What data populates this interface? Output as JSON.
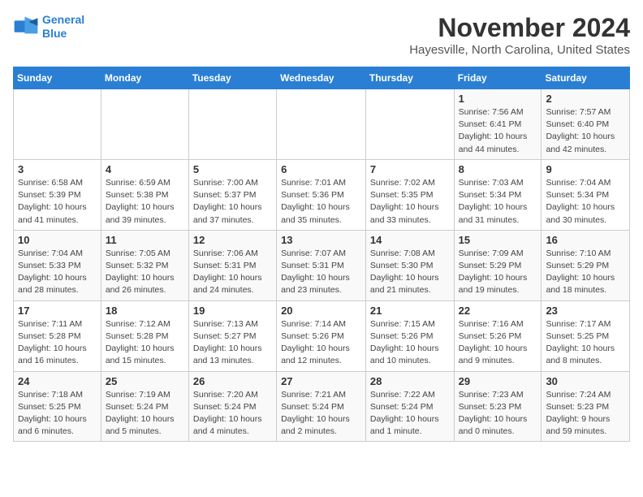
{
  "logo": {
    "line1": "General",
    "line2": "Blue"
  },
  "header": {
    "month_year": "November 2024",
    "location": "Hayesville, North Carolina, United States"
  },
  "days_of_week": [
    "Sunday",
    "Monday",
    "Tuesday",
    "Wednesday",
    "Thursday",
    "Friday",
    "Saturday"
  ],
  "weeks": [
    [
      {
        "day": "",
        "info": ""
      },
      {
        "day": "",
        "info": ""
      },
      {
        "day": "",
        "info": ""
      },
      {
        "day": "",
        "info": ""
      },
      {
        "day": "",
        "info": ""
      },
      {
        "day": "1",
        "info": "Sunrise: 7:56 AM\nSunset: 6:41 PM\nDaylight: 10 hours\nand 44 minutes."
      },
      {
        "day": "2",
        "info": "Sunrise: 7:57 AM\nSunset: 6:40 PM\nDaylight: 10 hours\nand 42 minutes."
      }
    ],
    [
      {
        "day": "3",
        "info": "Sunrise: 6:58 AM\nSunset: 5:39 PM\nDaylight: 10 hours\nand 41 minutes."
      },
      {
        "day": "4",
        "info": "Sunrise: 6:59 AM\nSunset: 5:38 PM\nDaylight: 10 hours\nand 39 minutes."
      },
      {
        "day": "5",
        "info": "Sunrise: 7:00 AM\nSunset: 5:37 PM\nDaylight: 10 hours\nand 37 minutes."
      },
      {
        "day": "6",
        "info": "Sunrise: 7:01 AM\nSunset: 5:36 PM\nDaylight: 10 hours\nand 35 minutes."
      },
      {
        "day": "7",
        "info": "Sunrise: 7:02 AM\nSunset: 5:35 PM\nDaylight: 10 hours\nand 33 minutes."
      },
      {
        "day": "8",
        "info": "Sunrise: 7:03 AM\nSunset: 5:34 PM\nDaylight: 10 hours\nand 31 minutes."
      },
      {
        "day": "9",
        "info": "Sunrise: 7:04 AM\nSunset: 5:34 PM\nDaylight: 10 hours\nand 30 minutes."
      }
    ],
    [
      {
        "day": "10",
        "info": "Sunrise: 7:04 AM\nSunset: 5:33 PM\nDaylight: 10 hours\nand 28 minutes."
      },
      {
        "day": "11",
        "info": "Sunrise: 7:05 AM\nSunset: 5:32 PM\nDaylight: 10 hours\nand 26 minutes."
      },
      {
        "day": "12",
        "info": "Sunrise: 7:06 AM\nSunset: 5:31 PM\nDaylight: 10 hours\nand 24 minutes."
      },
      {
        "day": "13",
        "info": "Sunrise: 7:07 AM\nSunset: 5:31 PM\nDaylight: 10 hours\nand 23 minutes."
      },
      {
        "day": "14",
        "info": "Sunrise: 7:08 AM\nSunset: 5:30 PM\nDaylight: 10 hours\nand 21 minutes."
      },
      {
        "day": "15",
        "info": "Sunrise: 7:09 AM\nSunset: 5:29 PM\nDaylight: 10 hours\nand 19 minutes."
      },
      {
        "day": "16",
        "info": "Sunrise: 7:10 AM\nSunset: 5:29 PM\nDaylight: 10 hours\nand 18 minutes."
      }
    ],
    [
      {
        "day": "17",
        "info": "Sunrise: 7:11 AM\nSunset: 5:28 PM\nDaylight: 10 hours\nand 16 minutes."
      },
      {
        "day": "18",
        "info": "Sunrise: 7:12 AM\nSunset: 5:28 PM\nDaylight: 10 hours\nand 15 minutes."
      },
      {
        "day": "19",
        "info": "Sunrise: 7:13 AM\nSunset: 5:27 PM\nDaylight: 10 hours\nand 13 minutes."
      },
      {
        "day": "20",
        "info": "Sunrise: 7:14 AM\nSunset: 5:26 PM\nDaylight: 10 hours\nand 12 minutes."
      },
      {
        "day": "21",
        "info": "Sunrise: 7:15 AM\nSunset: 5:26 PM\nDaylight: 10 hours\nand 10 minutes."
      },
      {
        "day": "22",
        "info": "Sunrise: 7:16 AM\nSunset: 5:26 PM\nDaylight: 10 hours\nand 9 minutes."
      },
      {
        "day": "23",
        "info": "Sunrise: 7:17 AM\nSunset: 5:25 PM\nDaylight: 10 hours\nand 8 minutes."
      }
    ],
    [
      {
        "day": "24",
        "info": "Sunrise: 7:18 AM\nSunset: 5:25 PM\nDaylight: 10 hours\nand 6 minutes."
      },
      {
        "day": "25",
        "info": "Sunrise: 7:19 AM\nSunset: 5:24 PM\nDaylight: 10 hours\nand 5 minutes."
      },
      {
        "day": "26",
        "info": "Sunrise: 7:20 AM\nSunset: 5:24 PM\nDaylight: 10 hours\nand 4 minutes."
      },
      {
        "day": "27",
        "info": "Sunrise: 7:21 AM\nSunset: 5:24 PM\nDaylight: 10 hours\nand 2 minutes."
      },
      {
        "day": "28",
        "info": "Sunrise: 7:22 AM\nSunset: 5:24 PM\nDaylight: 10 hours\nand 1 minute."
      },
      {
        "day": "29",
        "info": "Sunrise: 7:23 AM\nSunset: 5:23 PM\nDaylight: 10 hours\nand 0 minutes."
      },
      {
        "day": "30",
        "info": "Sunrise: 7:24 AM\nSunset: 5:23 PM\nDaylight: 9 hours\nand 59 minutes."
      }
    ]
  ]
}
